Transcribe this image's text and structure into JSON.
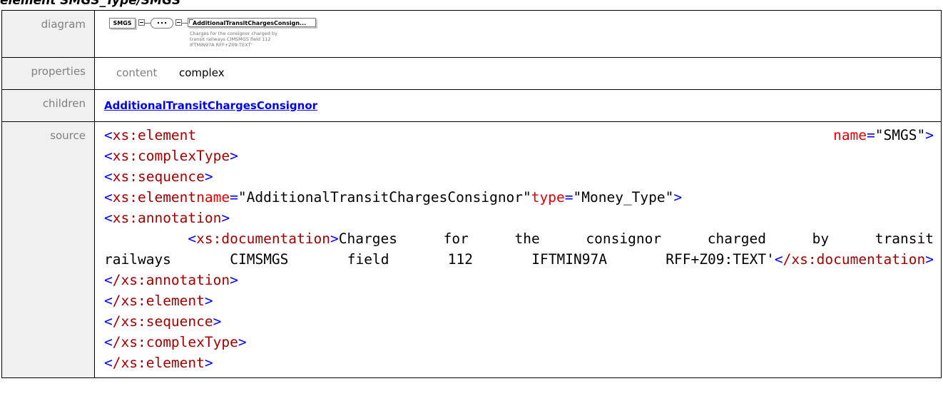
{
  "header": {
    "title_text": "element SMGS_Type/SMGS"
  },
  "rows": {
    "diagram": {
      "label": "diagram"
    },
    "properties": {
      "label": "properties",
      "name": "content",
      "value": "complex"
    },
    "children": {
      "label": "children",
      "link": "AdditionalTransitChargesConsignor"
    },
    "source": {
      "label": "source"
    }
  },
  "diagram": {
    "root": "SMGS",
    "child": "AdditionalTransitChargesConsign...",
    "doc_lines": [
      "Charges for the consignor charged by",
      "transit railways CIMSMGS field 112",
      "IFTMIN97A RFF+Z09:TEXT'"
    ]
  },
  "source_code": {
    "el1_tag": "xs:element",
    "el1_attr": "name",
    "el1_val": "\"SMGS\"",
    "complex_tag": "xs:complexType",
    "seq_tag": "xs:sequence",
    "el2_tag": "xs:element",
    "el2_attr1": "name",
    "el2_val1": "\"AdditionalTransitChargesConsignor\"",
    "el2_attr2": "type",
    "el2_val2": "\"Money_Type\"",
    "ann_tag": "xs:annotation",
    "doc_tag": "xs:documentation",
    "doc_words_line1": [
      "Charges",
      "for",
      "the",
      "consignor",
      "charged",
      "by",
      "transit"
    ],
    "doc_words_line2": [
      "railways",
      "CIMSMGS",
      "field",
      "112",
      "IFTMIN97A",
      "RFF+Z09:TEXT'"
    ],
    "doc_close": "/xs:documentation",
    "ann_close": "/xs:annotation",
    "el2_close": "/xs:element",
    "seq_close": "/xs:sequence",
    "complex_close": "/xs:complexType",
    "el1_close": "/xs:element"
  },
  "colors": {
    "tag": "#a00000",
    "bracket": "#0000ff",
    "attribute": "#e00000",
    "label_bg": "#f0f0f0",
    "link": "#0000ee"
  }
}
